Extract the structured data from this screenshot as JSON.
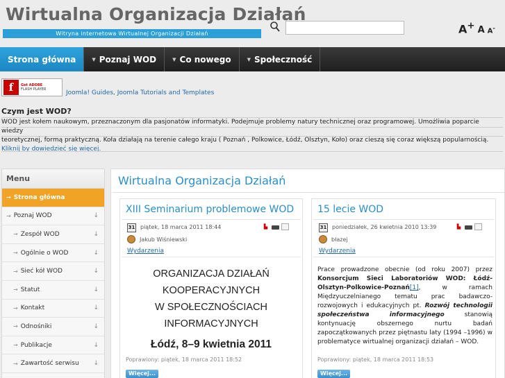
{
  "header": {
    "site_title": "Wirtualna Organizacja Działań",
    "tagline": "Witryna internetowa Wirtualnej Organizacji Działań",
    "font_large": "A",
    "font_large_plus": "+",
    "font_mid": "A",
    "font_small": "A",
    "font_small_minus": "-"
  },
  "nav": {
    "items": [
      {
        "label": "Strona główna"
      },
      {
        "label": "Poznaj WOD"
      },
      {
        "label": "Co nowego"
      },
      {
        "label": "Społeczność"
      }
    ]
  },
  "flash": {
    "logo": "f",
    "get": "Get ADOBE",
    "player": "FLASH PLAYER",
    "link": "Joomla! Guides, Joomla Tutorials and Templates"
  },
  "intro": {
    "title": "Czym jest WOD?",
    "line1": "WOD jest kołem naukowym, przeznaczonym dla pasjonatów informatyki. Podejmuje problemy natury technicznej oraz programowej. Umożliwia poparcie wiedzy",
    "line2": "teoretycznej, formą praktyczną. Koła działają na terenie całego kraju ( Poznań , Polkowice, Łódź, Olsztyn, Koło) oraz cieszą się coraz większą popularnością.",
    "link": "Kliknij by dowiedzieć się więcej."
  },
  "sidebar": {
    "heading": "Menu",
    "items": [
      {
        "label": "Strona główna"
      },
      {
        "label": "Poznaj WOD"
      },
      {
        "label": "Zespół WOD"
      },
      {
        "label": "Ogólnie o WOD"
      },
      {
        "label": "Sieć kół WOD"
      },
      {
        "label": "Statut"
      },
      {
        "label": "Kontakt"
      },
      {
        "label": "Odnośniki"
      },
      {
        "label": "Publikacje"
      },
      {
        "label": "Zawartość serwisu"
      }
    ]
  },
  "content": {
    "title": "Wirtualna Organizacja Działań",
    "articles": [
      {
        "title": "XIII Seminarium problemowe WOD",
        "cal": "31",
        "date": "piątek, 18 marca 2011 18:44",
        "author": "Jakub Wiśniewski",
        "category": "Wydarzenia",
        "poster": [
          "ORGANIZACJA DZIAŁAŃ",
          "KOOPERACYJNYCH",
          "W SPOŁECZNOŚCIACH",
          "INFORMACYJNYCH",
          "Łódź, 8–9 kwietnia 2011"
        ],
        "modified": "Poprawiony: piątek, 18 marca 2011 18:52",
        "more": "Więcej..."
      },
      {
        "title": "15 lecie WOD",
        "cal": "31",
        "date": "poniedziałek, 26 kwietnia 2010 13:39",
        "author": "błazej",
        "category": "Wydarzenia",
        "body": {
          "t1": "Prace prowadzone obecnie (od roku 2007) przez ",
          "b1": "Konsorcjum Sieci Laboratoriów WOD: Łódź-Olsztyn-Polkowice-Poznań",
          "ref": "[1]",
          "t2": ", w ramach Międzyuczelnianego tematu prac badawczo-rozwojowych i edukacyjnych pt. ",
          "i1": "Rozwój technologii społeczeństwa informacyjnego",
          "t3": " stanowią kontynuację obszernego nurtu badań zapoczątkowanych przez piętnastu laty (1994 –1996) w problematyce wirtualnej organizacji działań – WOD."
        },
        "modified": "Poprawiony: piątek, 18 marca 2011 18:53",
        "more": "Więcej..."
      }
    ]
  }
}
